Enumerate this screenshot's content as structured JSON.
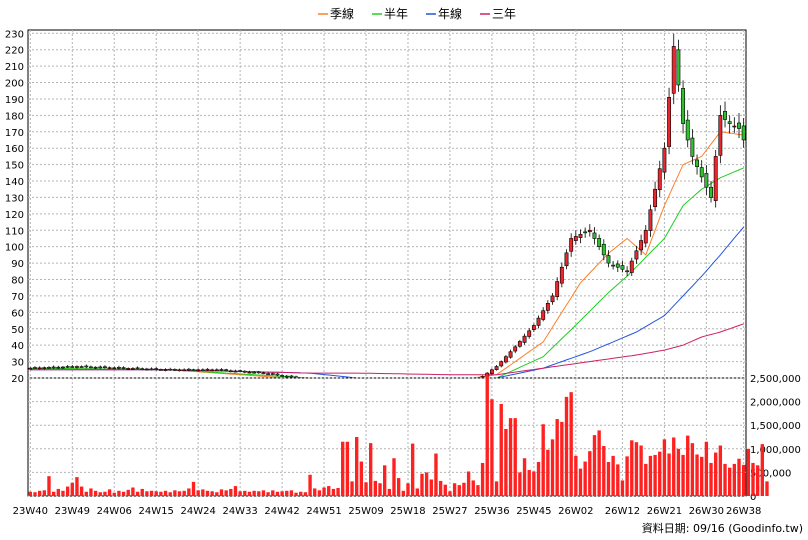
{
  "legend": [
    {
      "label": "季線",
      "color": "#ff7f27"
    },
    {
      "label": "半年",
      "color": "#22cc22"
    },
    {
      "label": "年線",
      "color": "#2255dd"
    },
    {
      "label": "三年",
      "color": "#cc2266"
    }
  ],
  "credit": "資料日期: 09/16  (Goodinfo.tw)",
  "chart_data": [
    {
      "type": "candlestick",
      "ylim": [
        20,
        232
      ],
      "yticks": [
        20,
        30,
        40,
        50,
        60,
        70,
        80,
        90,
        100,
        110,
        120,
        130,
        140,
        150,
        160,
        170,
        180,
        190,
        200,
        210,
        220,
        230
      ],
      "xticks": [
        "23W40",
        "23W49",
        "24W06",
        "24W15",
        "24W24",
        "24W33",
        "24W42",
        "24W51",
        "25W09",
        "25W18",
        "25W27",
        "25W36",
        "25W45",
        "26W02",
        "26W12",
        "26W21",
        "26W30",
        "26W38"
      ],
      "x_count": 154,
      "tick_index": [
        0,
        9,
        18,
        27,
        36,
        45,
        54,
        63,
        72,
        81,
        90,
        99,
        108,
        117,
        127,
        136,
        145,
        153
      ],
      "anchors": {
        "close_index": [
          0,
          10,
          20,
          30,
          40,
          50,
          60,
          68,
          74,
          80,
          90,
          96,
          100,
          104,
          108,
          112,
          116,
          120,
          124,
          128,
          132,
          136,
          138,
          140,
          142,
          146,
          148,
          150,
          152,
          153
        ],
        "close_value": [
          26,
          27,
          26,
          25,
          25,
          23,
          19,
          15,
          18,
          16,
          18,
          19,
          27,
          39,
          52,
          70,
          105,
          110,
          90,
          85,
          110,
          160,
          222,
          175,
          155,
          130,
          180,
          175,
          172,
          165
        ]
      },
      "moving_averages": [
        {
          "label": "季線",
          "color": "#ff7f27",
          "index": [
            0,
            30,
            60,
            70,
            90,
            100,
            110,
            118,
            124,
            128,
            132,
            136,
            140,
            144,
            148,
            153
          ],
          "value": [
            26,
            25,
            19,
            16,
            18,
            22,
            42,
            78,
            96,
            105,
            95,
            125,
            150,
            155,
            170,
            168
          ]
        },
        {
          "label": "半年",
          "color": "#22cc22",
          "index": [
            0,
            30,
            60,
            70,
            90,
            100,
            110,
            118,
            124,
            128,
            136,
            140,
            144,
            148,
            153
          ],
          "value": [
            26,
            25,
            20,
            17,
            18,
            20,
            33,
            55,
            72,
            82,
            105,
            125,
            135,
            142,
            148
          ]
        },
        {
          "label": "年線",
          "color": "#2255dd",
          "index": [
            0,
            30,
            60,
            70,
            90,
            100,
            110,
            120,
            130,
            136,
            140,
            144,
            148,
            153
          ],
          "value": [
            25,
            25,
            23,
            20,
            19,
            20,
            26,
            36,
            48,
            58,
            70,
            82,
            95,
            112
          ]
        },
        {
          "label": "三年",
          "color": "#cc2266",
          "index": [
            0,
            30,
            60,
            70,
            90,
            100,
            110,
            120,
            130,
            136,
            140,
            144,
            148,
            153
          ],
          "value": [
            25,
            25,
            23,
            23,
            22,
            22,
            26,
            30,
            34,
            37,
            40,
            45,
            48,
            53
          ]
        }
      ]
    },
    {
      "type": "bar",
      "ylim": [
        0,
        2500000
      ],
      "yticks": [
        0,
        500000,
        1000000,
        1500000,
        2000000,
        2500000
      ],
      "ytick_labels": [
        "0",
        "500,000",
        "1,000,000",
        "1,500,000",
        "2,000,000",
        "2,500,000"
      ],
      "values": [
        90000,
        80000,
        110000,
        120000,
        420000,
        90000,
        150000,
        110000,
        200000,
        280000,
        400000,
        200000,
        90000,
        160000,
        110000,
        80000,
        90000,
        140000,
        70000,
        110000,
        90000,
        130000,
        180000,
        90000,
        150000,
        100000,
        110000,
        100000,
        90000,
        110000,
        80000,
        120000,
        100000,
        110000,
        160000,
        300000,
        120000,
        140000,
        110000,
        100000,
        80000,
        140000,
        120000,
        150000,
        210000,
        100000,
        110000,
        90000,
        110000,
        100000,
        120000,
        80000,
        120000,
        90000,
        100000,
        110000,
        120000,
        70000,
        90000,
        80000,
        450000,
        160000,
        120000,
        180000,
        210000,
        150000,
        170000,
        1150000,
        1150000,
        310000,
        1250000,
        730000,
        290000,
        1120000,
        320000,
        270000,
        650000,
        150000,
        800000,
        380000,
        110000,
        270000,
        1110000,
        160000,
        470000,
        500000,
        350000,
        900000,
        320000,
        240000,
        100000,
        270000,
        230000,
        280000,
        520000,
        330000,
        230000,
        700000,
        2550000,
        2050000,
        310000,
        1950000,
        1420000,
        1650000,
        1650000,
        500000,
        800000,
        550000,
        520000,
        720000,
        1520000,
        980000,
        1200000,
        1630000,
        1570000,
        2100000,
        2200000,
        850000,
        580000,
        730000,
        950000,
        1290000,
        1390000,
        1060000,
        720000,
        850000,
        670000,
        330000,
        840000,
        1180000,
        1140000,
        1070000,
        680000,
        850000,
        870000,
        940000,
        1200000,
        900000,
        1240000,
        1000000,
        870000,
        1280000,
        1120000,
        880000,
        830000,
        1150000,
        700000,
        920000,
        1070000,
        680000,
        600000,
        680000,
        790000,
        660000,
        1000000,
        700000,
        650000,
        1100000,
        310000
      ]
    }
  ]
}
